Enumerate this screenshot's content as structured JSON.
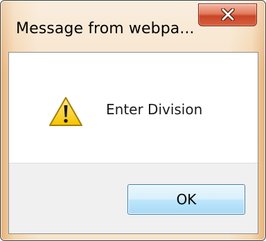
{
  "dialog": {
    "title": "Message from webpa...",
    "message": "Enter Division",
    "icon": "warning-icon",
    "ok_label": "OK",
    "close_icon": "close-icon"
  },
  "colors": {
    "close_button": "#d8603e",
    "frame": "#f7e4cc",
    "button_area": "#f0f0f0",
    "ok_border": "#3c7fb1"
  }
}
